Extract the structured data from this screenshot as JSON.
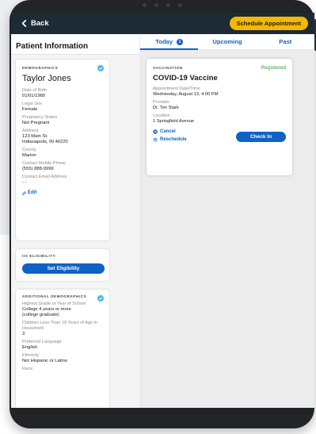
{
  "topbar": {
    "back_label": "Back",
    "schedule_label": "Schedule Appointment"
  },
  "left": {
    "title": "Patient Information",
    "demographics": {
      "section_label": "DEMOGRAPHICS",
      "name": "Taylor Jones",
      "fields": [
        {
          "label": "Date of Birth",
          "value": "01/01/1980"
        },
        {
          "label": "Legal Sex",
          "value": "Female"
        },
        {
          "label": "Pregnancy Status",
          "value": "Not Pregnant"
        },
        {
          "label": "Address",
          "value": "123 Main St."
        },
        {
          "label": "",
          "value": "Indianapolis, IN 46220"
        },
        {
          "label": "County",
          "value": "Marion"
        },
        {
          "label": "Contact Mobile Phone",
          "value": "(555) 888-9999"
        },
        {
          "label": "Contact Email Address",
          "value": "- -"
        }
      ],
      "edit_label": "Edit"
    },
    "iis": {
      "section_label": "IIS ELIGIBILITY",
      "button_label": "Set Eligibility"
    },
    "additional": {
      "section_label": "ADDITIONAL DEMOGRAPHICS",
      "fields": [
        {
          "label": "Highest Grade or Year of School",
          "value": "College 4 years or more"
        },
        {
          "label": "",
          "value": "(college graduate)"
        },
        {
          "label": "Children Less Than 18 Years of Age in Household",
          "value": "3"
        },
        {
          "label": "Preferred Language",
          "value": "English"
        },
        {
          "label": "Ethnicity",
          "value": "Not Hispanic or Latino"
        },
        {
          "label": "Race",
          "value": ""
        }
      ]
    }
  },
  "tabs": [
    {
      "label": "Today",
      "badge": "1",
      "active": true
    },
    {
      "label": "Upcoming",
      "badge": "",
      "active": false
    },
    {
      "label": "Past",
      "badge": "",
      "active": false
    }
  ],
  "vaccination": {
    "section_label": "VACCINATION",
    "status": "Registered",
    "title": "COVID-19 Vaccine",
    "fields": [
      {
        "label": "Appointment Date/Time",
        "value": "Wednesday, August 13, 4:00 PM"
      },
      {
        "label": "Provider",
        "value": "Dr. Tim Stark"
      },
      {
        "label": "Location",
        "value": "1 Springfield Avenue"
      }
    ],
    "cancel_label": "Cancel",
    "reschedule_label": "Reschedule",
    "checkin_label": "Check In"
  },
  "colors": {
    "primary": "#0f62c5",
    "accent": "#f5b800",
    "status_green": "#2ea043",
    "check_blue": "#4ab8e5",
    "topbar": "#1e2a34"
  }
}
